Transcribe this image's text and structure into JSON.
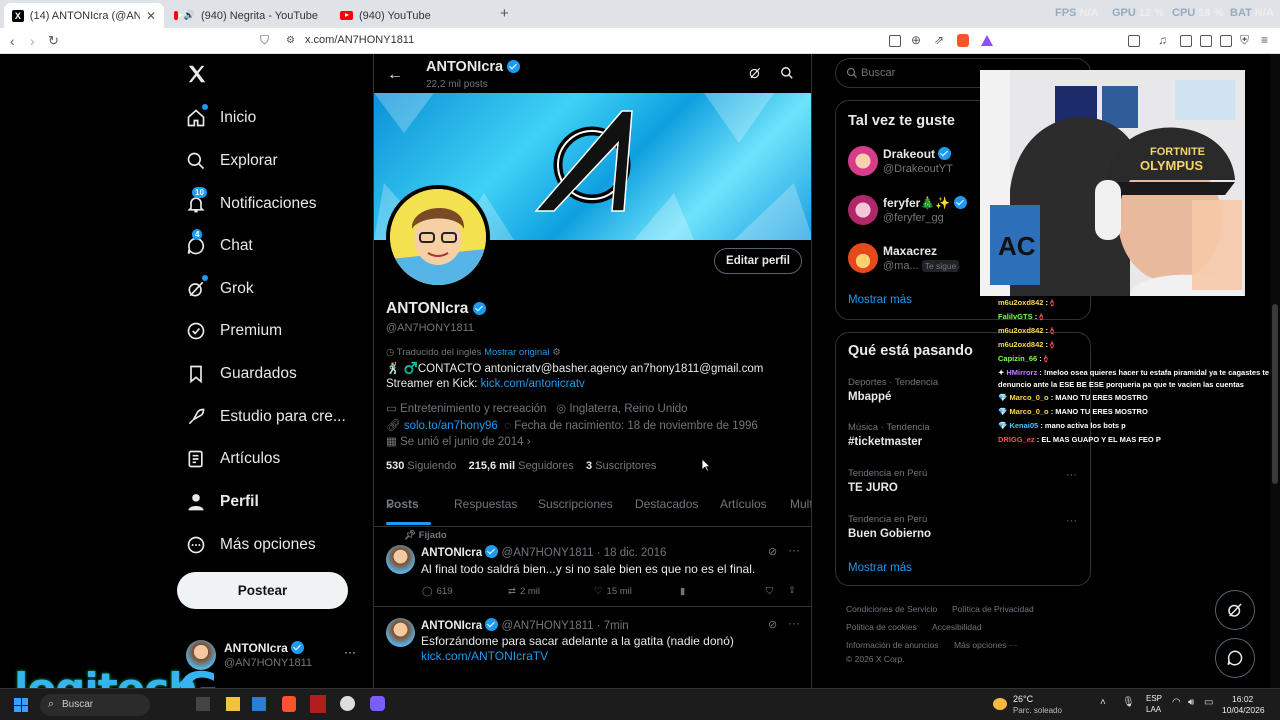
{
  "browser": {
    "tabs": [
      {
        "label": "(14) ANTONIcra (@AN7HONY18",
        "icon": "x-favicon"
      },
      {
        "label": "(940) Negrita - YouTube",
        "icon": "youtube-favicon"
      },
      {
        "label": "(940) YouTube",
        "icon": "youtube-favicon"
      }
    ],
    "new_tab": "+",
    "url": "x.com/AN7HONY1811",
    "perf": {
      "fps_label": "FPS",
      "fps_val": "N/A",
      "gpu_label": "GPU",
      "gpu_val": "12 %",
      "cpu_label": "CPU",
      "cpu_val": "18 %",
      "bat_label": "BAT",
      "bat_val": "N/A"
    }
  },
  "nav": {
    "items": [
      {
        "label": "Inicio",
        "icon": "home-icon"
      },
      {
        "label": "Explorar",
        "icon": "search-icon"
      },
      {
        "label": "Notificaciones",
        "icon": "bell-icon",
        "badge": "10"
      },
      {
        "label": "Chat",
        "icon": "chat-icon",
        "badge": "4"
      },
      {
        "label": "Grok",
        "icon": "grok-icon"
      },
      {
        "label": "Premium",
        "icon": "premium-icon"
      },
      {
        "label": "Guardados",
        "icon": "bookmark-icon"
      },
      {
        "label": "Estudio para cre...",
        "icon": "rocket-icon"
      },
      {
        "label": "Artículos",
        "icon": "article-icon"
      },
      {
        "label": "Perfil",
        "icon": "person-icon"
      },
      {
        "label": "Más opciones",
        "icon": "more-circle-icon"
      }
    ],
    "post_button": "Postear",
    "account": {
      "name": "ANTONIcra",
      "handle": "@AN7HONY1811",
      "more": "···"
    }
  },
  "profile": {
    "header_name": "ANTONIcra",
    "header_posts": "22,2 mil posts",
    "edit_button": "Editar perfil",
    "name": "ANTONIcra",
    "handle": "@AN7HONY1811",
    "translated_label": "Traducido del inglés",
    "show_original": "Mostrar original",
    "bio_text": "🕺 ♂️CONTACTO antonicratv@basher.agency an7hony1811@gmail.com Streamer en Kick:",
    "bio_link": "kick.com/antonicratv",
    "category": "Entretenimiento y recreación",
    "location": "Inglaterra, Reino Unido",
    "website": "solo.to/an7hony96",
    "birthday": "Fecha de nacimiento: 18 de noviembre de 1996",
    "joined": "Se unió el junio de 2014",
    "following_count": "530",
    "following_label": "Siguiendo",
    "followers_count": "215,6 mil",
    "followers_label": "Seguidores",
    "subs_count": "3",
    "subs_label": "Suscriptores",
    "tabs": [
      "Posts",
      "Respuestas",
      "Suscripciones",
      "Destacados",
      "Artículos",
      "Mult"
    ]
  },
  "tweets": [
    {
      "pinned": "Fijado",
      "name": "ANTONIcra",
      "handle": "@AN7HONY1811",
      "time": "· 18 dic. 2016",
      "text": "Al final todo saldrá bien...y si no sale bien es que no es el final.",
      "replies": "619",
      "reposts": "2 mil",
      "likes": "15 mil"
    },
    {
      "name": "ANTONIcra",
      "handle": "@AN7HONY1811",
      "time": "· 7min",
      "text": "Esforzándome para sacar adelante a la gatita (nadie donó)",
      "link": "kick.com/ANTONIcraTV"
    }
  ],
  "right": {
    "search_placeholder": "Buscar",
    "suggest_title": "Tal vez te guste",
    "suggestions": [
      {
        "name": "Drakeout",
        "handle": "@DrakeoutYT"
      },
      {
        "name": "feryfer🎄✨",
        "handle": "@feryfer_gg"
      },
      {
        "name": "Maxacrez",
        "handle": "@ma...",
        "follows_you": "Te sigue"
      }
    ],
    "show_more": "Mostrar más",
    "trends_title": "Qué está pasando",
    "trends": [
      {
        "cat": "Deportes · Tendencia",
        "name": "Mbappé"
      },
      {
        "cat": "Música · Tendencia",
        "name": "#ticketmaster"
      },
      {
        "cat": "Tendencia en Perú",
        "name": "TE JURO"
      },
      {
        "cat": "Tendencia en Perú",
        "name": "Buen Gobierno"
      }
    ],
    "trends_more": "Mostrar más",
    "footer": [
      "Condiciones de Servicio",
      "Política de Privacidad",
      "Política de cookies",
      "Accesibilidad",
      "Información de anuncios",
      "Más opciones ···",
      "© 2026 X Corp."
    ]
  },
  "chat": [
    {
      "user": "m6u2oxd842",
      "msg": ":",
      "color": "#ffd54a"
    },
    {
      "user": "FalilvGTS",
      "msg": ":",
      "color": "#7cfc5a"
    },
    {
      "user": "m6u2oxd842",
      "msg": ":",
      "color": "#ffd54a"
    },
    {
      "user": "m6u2oxd842",
      "msg": ":",
      "color": "#ffd54a"
    },
    {
      "user": "Capizin_66",
      "msg": ":",
      "color": "#7cfc5a"
    },
    {
      "user": "HMirrorz",
      "msg": ": !meloo osea quieres hacer tu estafa piramidal ya te cagastes te",
      "color": "#c77dff"
    },
    {
      "user": "",
      "msg": "denuncio ante la ESE BE ESE porqueria pa que te vacien las cuentas",
      "color": "#fff"
    },
    {
      "user": "Marco_0_o",
      "msg": ": MANO TU ERES MOSTRO",
      "color": "#ffd54a"
    },
    {
      "user": "Marco_0_o",
      "msg": ": MANO TU ERES MOSTRO",
      "color": "#ffd54a"
    },
    {
      "user": "Kenai05",
      "msg": ": mano activa los bots p",
      "color": "#4fc3f7"
    },
    {
      "user": "DRIGG_ez",
      "msg": ": EL MAS GUAPO Y EL MAS FEO P",
      "color": "#ff4d4d"
    }
  ],
  "overlay": {
    "logo_text": "logitech",
    "logo_g": "G"
  },
  "taskbar": {
    "search": "Buscar",
    "weather_temp": "26°C",
    "weather_desc": "Parc. soleado",
    "lang1": "ESP",
    "lang2": "LAA",
    "time": "16:02",
    "date": "10/04/2026"
  },
  "colors": {
    "accent": "#1d9bf0",
    "border": "#2f3336",
    "muted": "#71767b"
  }
}
